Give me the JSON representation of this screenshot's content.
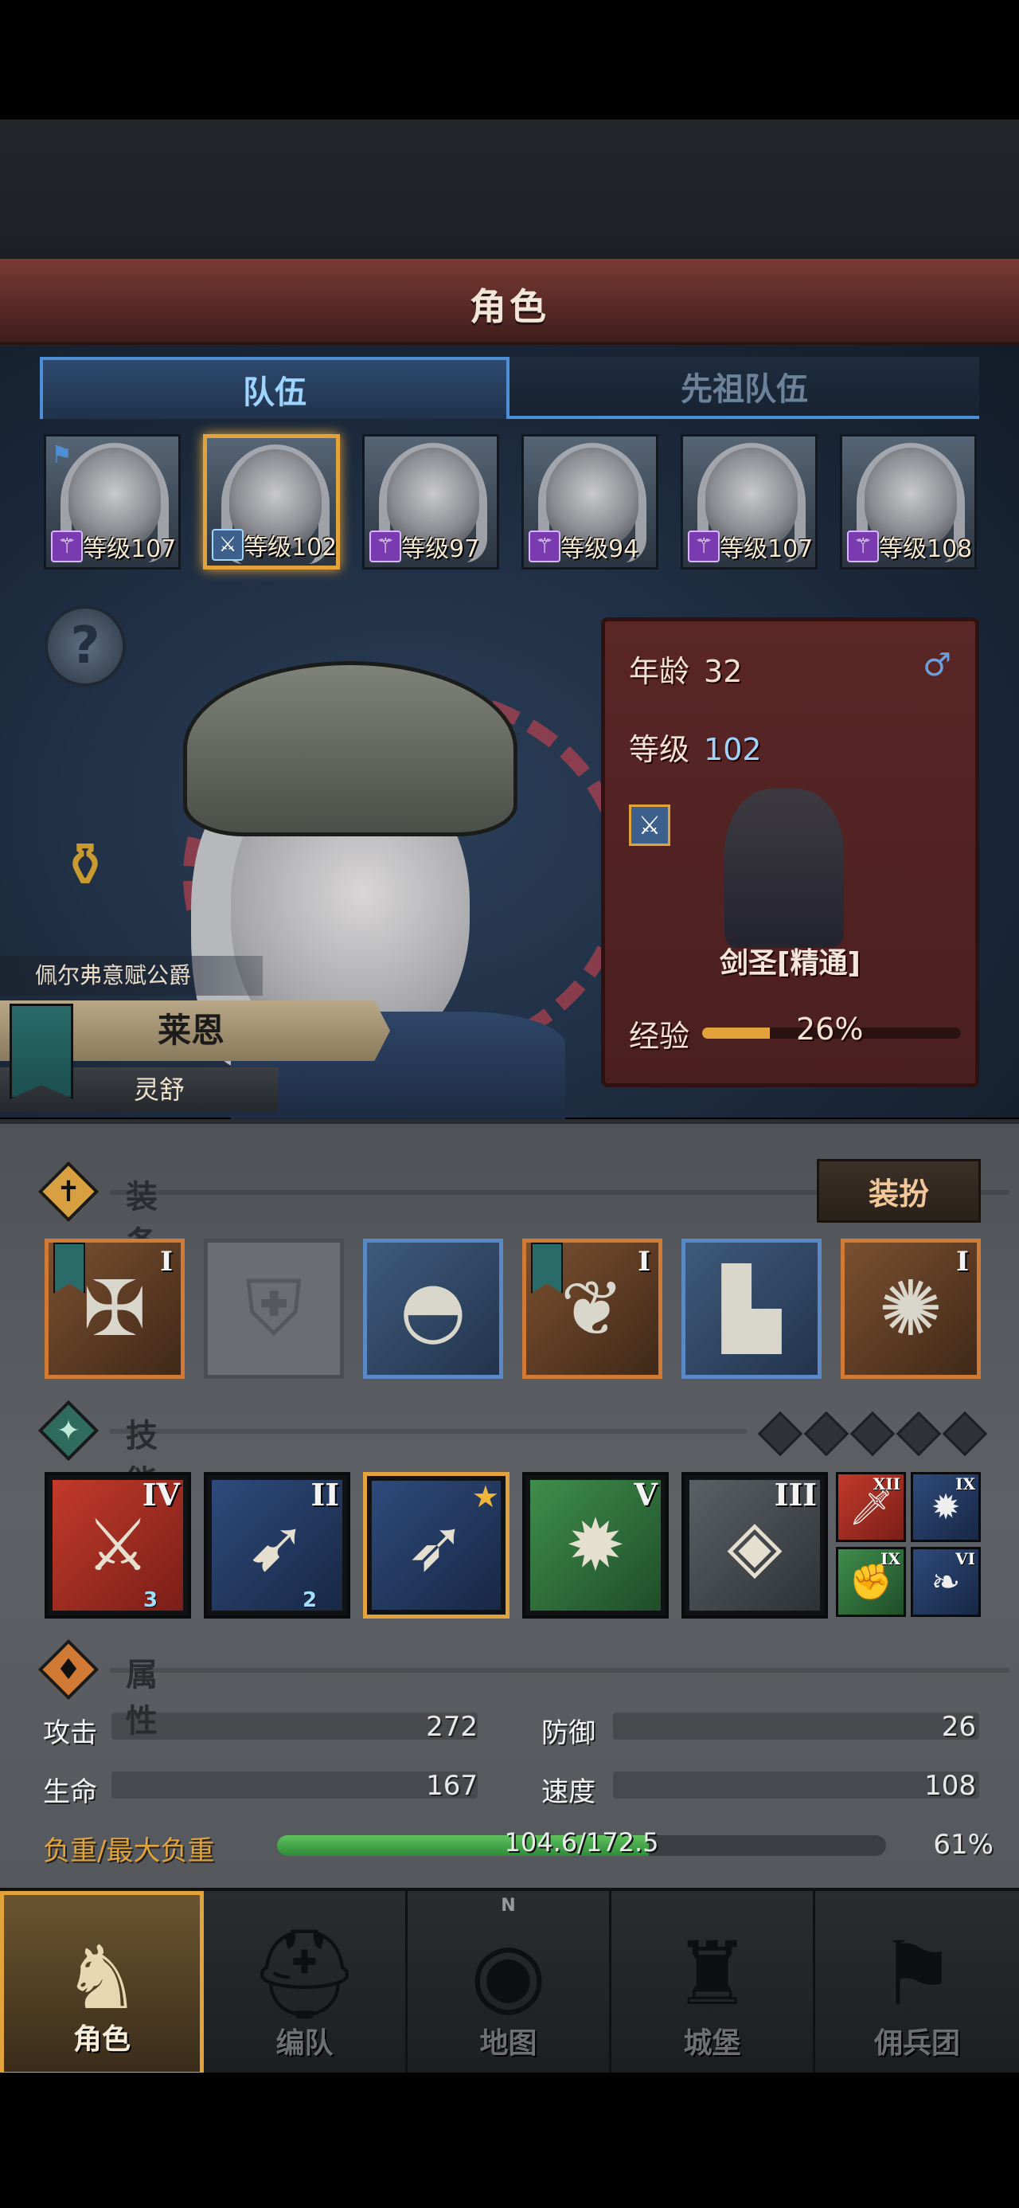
{
  "header": {
    "title": "角色"
  },
  "tabs": [
    {
      "label": "队伍",
      "active": true
    },
    {
      "label": "先祖队伍",
      "active": false
    }
  ],
  "roster": [
    {
      "level_text": "等级107",
      "class_icon": "staff-icon",
      "flag": true,
      "selected": false
    },
    {
      "level_text": "等级102",
      "class_icon": "sword-icon",
      "flag": false,
      "selected": true
    },
    {
      "level_text": "等级97",
      "class_icon": "staff-icon",
      "flag": false,
      "selected": false
    },
    {
      "level_text": "等级94",
      "class_icon": "staff-icon",
      "flag": false,
      "selected": false
    },
    {
      "level_text": "等级107",
      "class_icon": "staff-icon",
      "flag": false,
      "selected": false
    },
    {
      "level_text": "等级108",
      "class_icon": "staff-icon",
      "flag": false,
      "selected": false
    }
  ],
  "character": {
    "house": "佩尔弗意赋公爵",
    "name": "莱恩",
    "subtitle": "灵舒",
    "age_label": "年龄",
    "age": "32",
    "gender_icon": "male-icon",
    "level_label": "等级",
    "level": "102",
    "class_name": "剑圣[精通]",
    "exp_label": "经验",
    "exp_percent_text": "26%",
    "exp_fraction": 0.26
  },
  "equipment": {
    "title": "装备",
    "dress_button": "装扮",
    "slots": [
      {
        "tier": "I",
        "rarity": "orange",
        "icon": "crossed-weapon-icon",
        "banner": true
      },
      {
        "tier": "",
        "rarity": "empty",
        "icon": "shield-icon",
        "banner": false
      },
      {
        "tier": "",
        "rarity": "blue",
        "icon": "hood-icon",
        "banner": false
      },
      {
        "tier": "I",
        "rarity": "orange",
        "icon": "armor-icon",
        "banner": true
      },
      {
        "tier": "",
        "rarity": "blue",
        "icon": "boots-icon",
        "banner": false
      },
      {
        "tier": "I",
        "rarity": "orange",
        "icon": "amulet-icon",
        "banner": false
      }
    ]
  },
  "skills": {
    "title": "技能",
    "main": [
      {
        "tier": "IV",
        "color": "red",
        "icon": "slash-icon",
        "gem": "3"
      },
      {
        "tier": "II",
        "color": "blue",
        "icon": "lunge-icon",
        "gem": "2"
      },
      {
        "tier": "",
        "color": "blue",
        "icon": "thrust-icon",
        "gem": "",
        "starred": true
      },
      {
        "tier": "V",
        "color": "green",
        "icon": "burst-icon",
        "gem": ""
      },
      {
        "tier": "III",
        "color": "gray",
        "icon": "crystal-icon",
        "gem": ""
      }
    ],
    "passive": [
      {
        "tier": "XII",
        "color": "red",
        "icon": "sword-icon"
      },
      {
        "tier": "IX",
        "color": "blue",
        "icon": "burst-icon"
      },
      {
        "tier": "IX",
        "color": "green",
        "icon": "fist-icon"
      },
      {
        "tier": "VI",
        "color": "blue",
        "icon": "wing-icon"
      }
    ]
  },
  "attributes": {
    "title": "属性",
    "attack_label": "攻击",
    "attack": "272",
    "defense_label": "防御",
    "defense": "26",
    "hp_label": "生命",
    "hp": "167",
    "speed_label": "速度",
    "speed": "108",
    "load_label": "负重/最大负重",
    "load_text": "104.6/172.5",
    "load_percent_text": "61%",
    "load_fraction": 0.61
  },
  "nav": [
    {
      "label": "角色",
      "icon": "knight-icon",
      "active": true
    },
    {
      "label": "编队",
      "icon": "helmet-icon",
      "active": false
    },
    {
      "label": "地图",
      "icon": "compass-icon",
      "active": false,
      "compass_n": "N"
    },
    {
      "label": "城堡",
      "icon": "castle-icon",
      "active": false
    },
    {
      "label": "佣兵团",
      "icon": "tower-icon",
      "active": false
    }
  ],
  "colors": {
    "accent": "#e3a33b",
    "tab_blue": "#4d8fd6",
    "title_red": "#5a2a26",
    "load_green": "#3fa64a"
  }
}
